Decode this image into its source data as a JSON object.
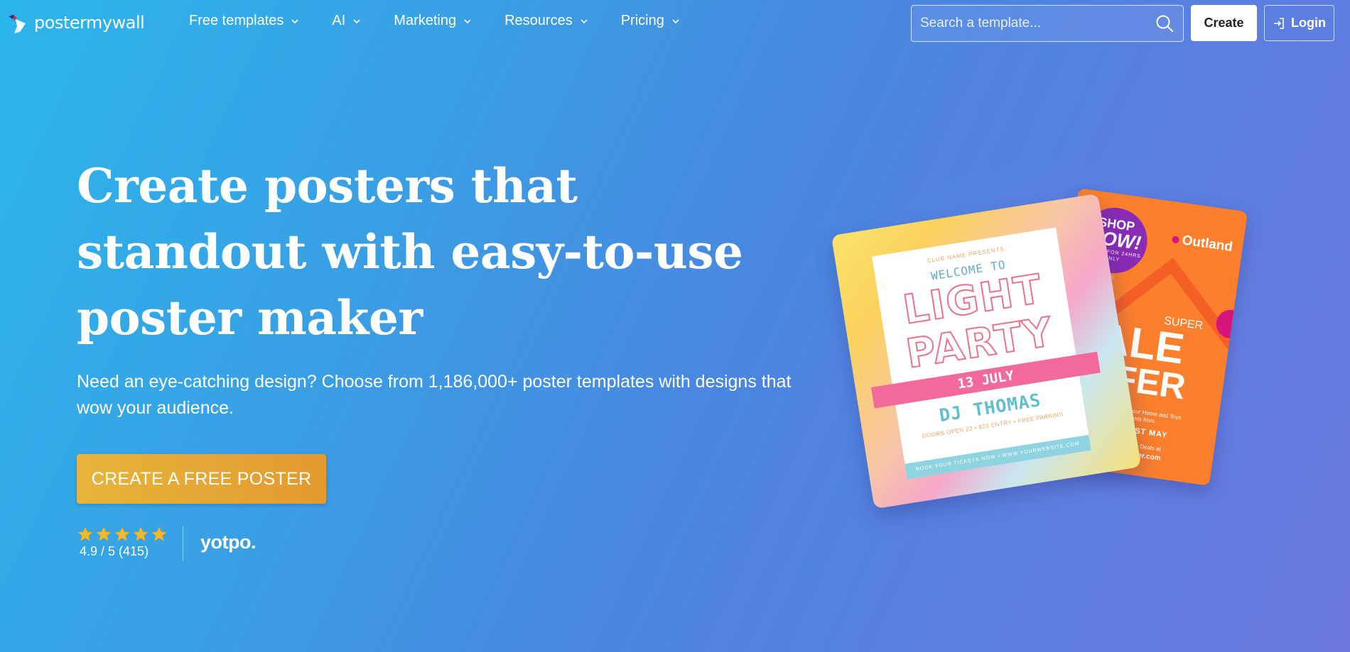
{
  "brand": {
    "name": "postermywall"
  },
  "nav": {
    "items": [
      {
        "label": "Free templates"
      },
      {
        "label": "AI"
      },
      {
        "label": "Marketing"
      },
      {
        "label": "Resources"
      },
      {
        "label": "Pricing"
      }
    ],
    "search_placeholder": "Search a template...",
    "create_label": "Create",
    "login_label": "Login"
  },
  "hero": {
    "title": "Create posters that standout with easy-to-use poster maker",
    "subtitle": "Need an eye-catching design? Choose from 1,186,000+ poster templates with designs that wow your audience.",
    "cta_label": "CREATE A FREE POSTER",
    "rating_text": "4.9 / 5 (415)",
    "rating_value": 4.9,
    "rating_max": 5,
    "review_provider": "yotpo."
  },
  "poster_party": {
    "small": "CLUB NAME PRESENTS",
    "welcome": "WELCOME TO",
    "line1": "LIGHT",
    "line2": "PARTY",
    "date": "13 JULY",
    "dj": "DJ THOMAS",
    "info": "DOORS OPEN 22 • $25 ENTRY • FREE PARKING",
    "footer": "BOOK YOUR TICKETS NOW • WWW.YOURWEBSITE.COM"
  },
  "poster_sale": {
    "shop1": "SHOP",
    "shop2": "NOW!",
    "shop3": "OFFER FOR 24HRS ONLY",
    "brand": "Outland",
    "super": "SUPER",
    "sale": "SALE",
    "offer": "OFFER",
    "small": "Sale Deals across our Home and Toys departments from",
    "dates": "26TH - 31ST MAY",
    "exclusive": "Online Exclusive Deals at",
    "url": "www.outlander.com"
  },
  "colors": {
    "cta_start": "#e6b43c",
    "cta_end": "#e39a2e",
    "star": "#f5b92e"
  }
}
